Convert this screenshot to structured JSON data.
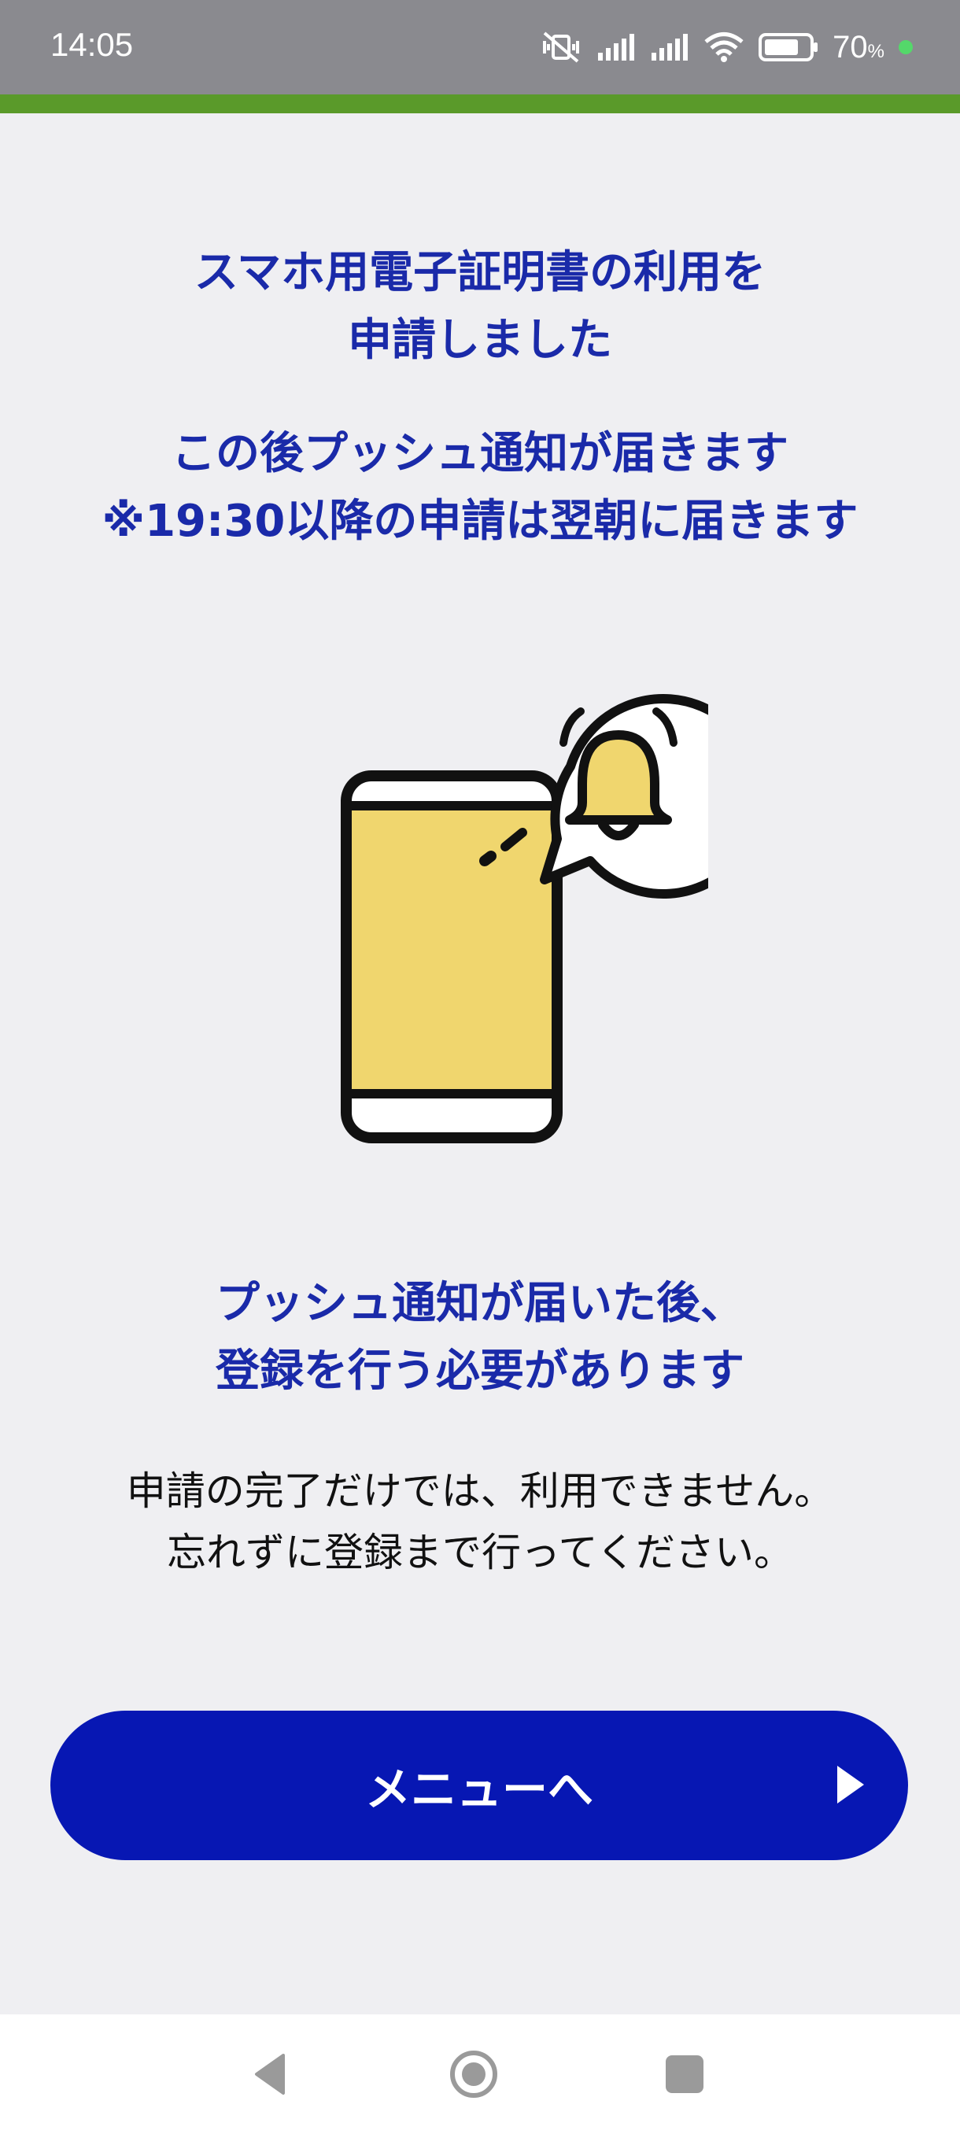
{
  "status_bar": {
    "time": "14:05",
    "battery_percent": "70",
    "battery_unit": "%",
    "icons": [
      "mute-vibrate-icon",
      "signal-icon",
      "signal-icon",
      "wifi-icon",
      "battery-icon",
      "green-dot-indicator"
    ]
  },
  "main": {
    "title_line1": "スマホ用電子証明書の利用を",
    "title_line2": "申請しました",
    "notice_line1": "この後プッシュ通知が届きます",
    "notice_line2": "※19:30以降の申請は翌朝に届きます",
    "illustration": "phone-with-notification-bell-icon",
    "sub_line1": "プッシュ通知が届いた後、",
    "sub_line2": "登録を行う必要があります",
    "body_line1": "申請の完了だけでは、利用できません。",
    "body_line2": "忘れずに登録まで行ってください。"
  },
  "button": {
    "label": "メニューへ"
  },
  "colors": {
    "accent_green": "#5a9a2a",
    "text_blue": "#1a2aa9",
    "button_blue": "#0717b3",
    "phone_yellow": "#f0d66e"
  },
  "nav": {
    "icons": [
      "back-icon",
      "home-icon",
      "recent-apps-icon"
    ]
  }
}
